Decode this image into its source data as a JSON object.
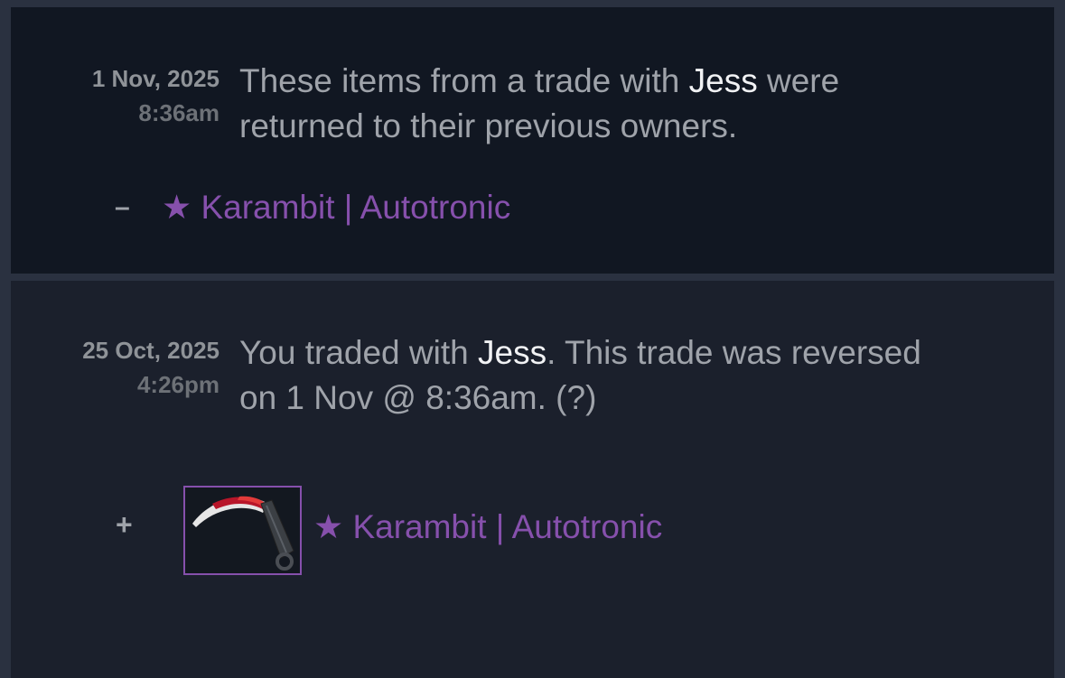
{
  "history": [
    {
      "date": "1 Nov, 2025",
      "time": "8:36am",
      "desc_before": "These items from a trade with ",
      "partner": "Jess",
      "desc_after_line1": " were",
      "desc_line2": "returned to their previous owners.",
      "item_sign": "–",
      "item_name": "★ Karambit | Autotronic"
    },
    {
      "date": "25 Oct, 2025",
      "time": "4:26pm",
      "desc_before": "You traded with ",
      "partner": "Jess",
      "desc_after_line1": ". This trade was reversed",
      "desc_line2": "on 1 Nov @ 8:36am. (?)",
      "item_sign": "+",
      "item_name": "★ Karambit | Autotronic",
      "item_icon": "karambit-knife-icon"
    }
  ],
  "colors": {
    "background": "#2a3140",
    "panel_dark": "#111722",
    "panel_light": "#1b202c",
    "item_purple": "#8650ac",
    "text_gray": "#9fa3aa",
    "partner_white": "#f1f2f4"
  }
}
